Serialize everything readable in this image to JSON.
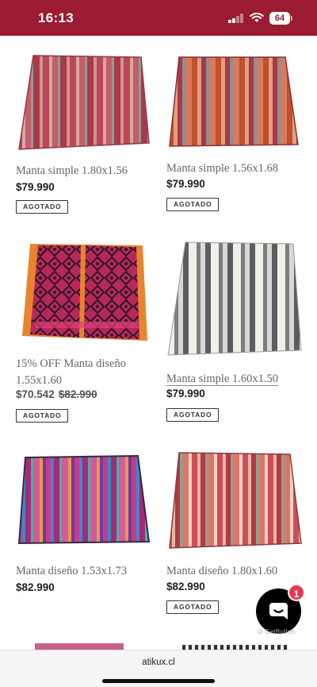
{
  "status_bar": {
    "time": "16:13",
    "battery": "64"
  },
  "products": [
    {
      "name": "Manta simple 1.80x1.56",
      "price": "$79.990",
      "old_price": "",
      "badge": "AGOTADO"
    },
    {
      "name": "Manta simple 1.56x1.68",
      "price": "$79.990",
      "old_price": "",
      "badge": "AGOTADO"
    },
    {
      "name": "15% OFF Manta diseño 1.55x1.60",
      "price": "$70.542",
      "old_price": "$82.990",
      "badge": "AGOTADO"
    },
    {
      "name": "Manta simple 1.60x1.50",
      "price": "$79.990",
      "old_price": "",
      "badge": "AGOTADO"
    },
    {
      "name": "Manta diseño 1.53x1.73",
      "price": "$82.990",
      "old_price": "",
      "badge": ""
    },
    {
      "name": "Manta diseño 1.80x1.60",
      "price": "$82.990",
      "old_price": "",
      "badge": "AGOTADO"
    }
  ],
  "chat": {
    "badge_count": "1",
    "brand": "GetButton"
  },
  "browser": {
    "url": "atikux.cl"
  },
  "colors": {
    "brand": "#9b1b30",
    "chat_badge": "#e8384f"
  }
}
